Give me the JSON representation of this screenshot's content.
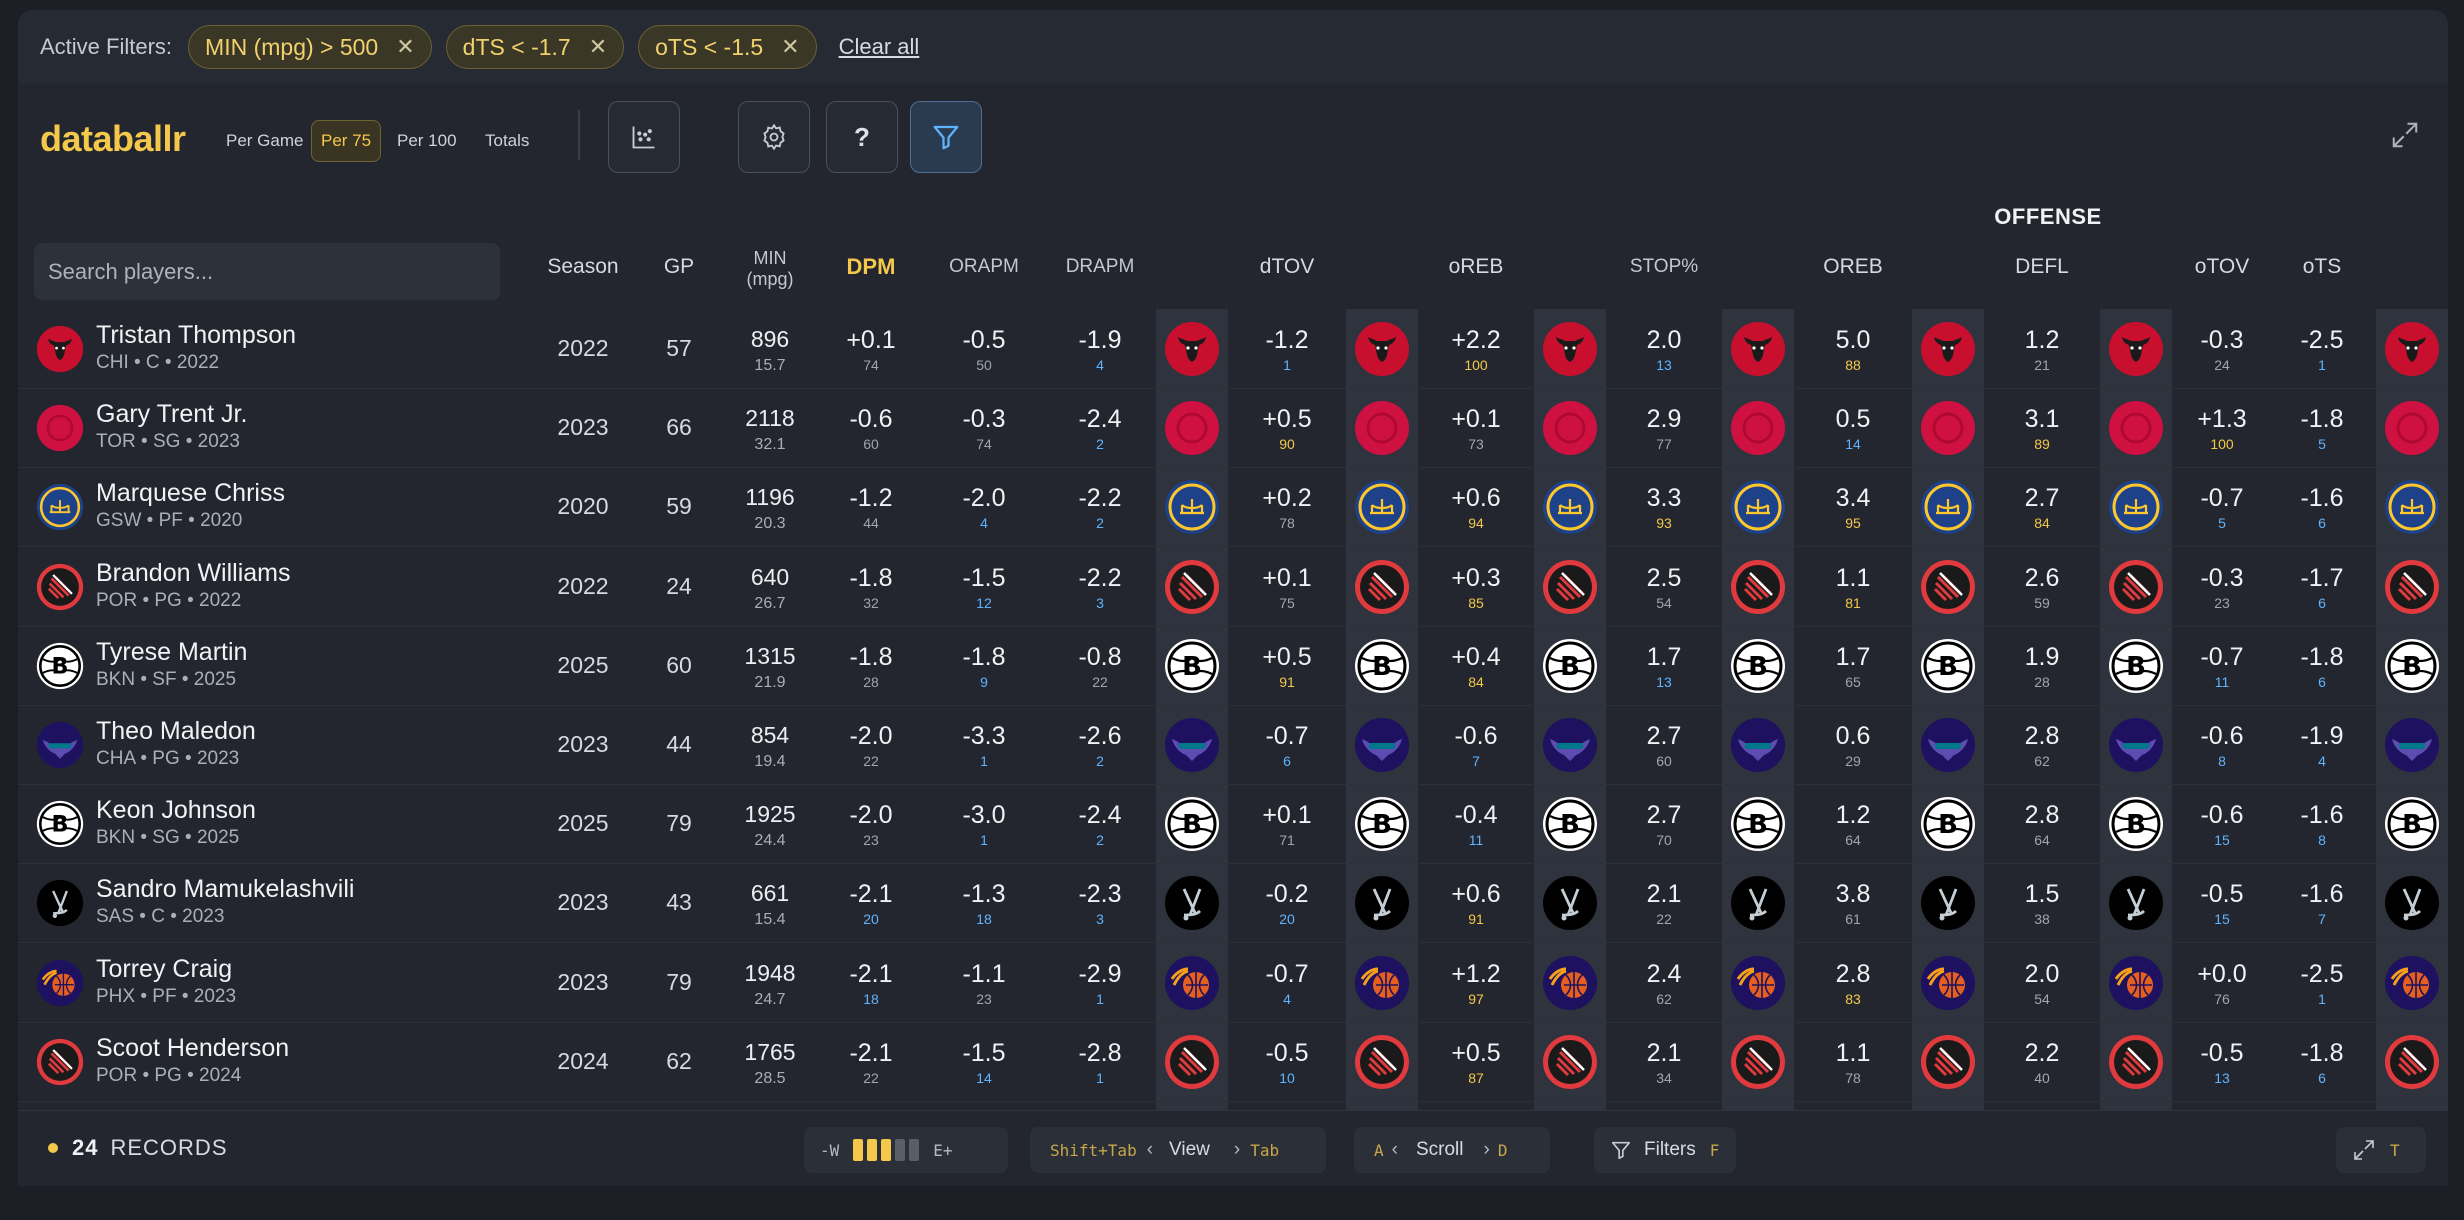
{
  "filters": {
    "label": "Active Filters:",
    "chips": [
      "MIN (mpg) > 500",
      "dTS < -1.7",
      "oTS < -1.5"
    ],
    "remove_symbol": "✕",
    "clear_all": "Clear all"
  },
  "toolbar": {
    "logo": "databallr",
    "modes": [
      "Per Game",
      "Per 75",
      "Per 100",
      "Totals"
    ],
    "active_mode": "Per 75",
    "buttons": [
      "chart-scatter-icon",
      "gear-icon",
      "help-icon",
      "filter-icon"
    ],
    "help_label": "?"
  },
  "table": {
    "group_header": "OFFENSE",
    "search_placeholder": "Search players...",
    "headers": {
      "season": "Season",
      "gp": "GP",
      "min_line1": "MIN",
      "min_line2": "(mpg)",
      "dpm": "DPM",
      "orapm": "ORAPM",
      "drapm": "DRAPM",
      "dtov": "dTOV",
      "oreb_lower": "oREB",
      "stop": "STOP%",
      "oreb": "OREB",
      "defl": "DEFL",
      "otov": "oTOV",
      "ots": "oTS"
    },
    "rows": [
      {
        "team": "CHI",
        "name": "Tristan Thompson",
        "meta": "CHI • C • 2022",
        "season": "2022",
        "gp": "57",
        "min": "896",
        "mpg": "15.7",
        "dpm": [
          "+0.1",
          "74"
        ],
        "orapm": [
          "-0.5",
          "50"
        ],
        "drapm": [
          "-1.9",
          "4"
        ],
        "dtov": [
          "-1.2",
          "1"
        ],
        "oreb_l": [
          "+2.2",
          "100"
        ],
        "stop": [
          "2.0",
          "13"
        ],
        "oreb": [
          "5.0",
          "88"
        ],
        "defl": [
          "1.2",
          "21"
        ],
        "otov": [
          "-0.3",
          "24"
        ],
        "ots": [
          "-2.5",
          "1"
        ]
      },
      {
        "team": "TOR",
        "name": "Gary Trent Jr.",
        "meta": "TOR • SG • 2023",
        "season": "2023",
        "gp": "66",
        "min": "2118",
        "mpg": "32.1",
        "dpm": [
          "-0.6",
          "60"
        ],
        "orapm": [
          "-0.3",
          "74"
        ],
        "drapm": [
          "-2.4",
          "2"
        ],
        "dtov": [
          "+0.5",
          "90"
        ],
        "oreb_l": [
          "+0.1",
          "73"
        ],
        "stop": [
          "2.9",
          "77"
        ],
        "oreb": [
          "0.5",
          "14"
        ],
        "defl": [
          "3.1",
          "89"
        ],
        "otov": [
          "+1.3",
          "100"
        ],
        "ots": [
          "-1.8",
          "5"
        ]
      },
      {
        "team": "GSW",
        "name": "Marquese Chriss",
        "meta": "GSW • PF • 2020",
        "season": "2020",
        "gp": "59",
        "min": "1196",
        "mpg": "20.3",
        "dpm": [
          "-1.2",
          "44"
        ],
        "orapm": [
          "-2.0",
          "4"
        ],
        "drapm": [
          "-2.2",
          "2"
        ],
        "dtov": [
          "+0.2",
          "78"
        ],
        "oreb_l": [
          "+0.6",
          "94"
        ],
        "stop": [
          "3.3",
          "93"
        ],
        "oreb": [
          "3.4",
          "95"
        ],
        "defl": [
          "2.7",
          "84"
        ],
        "otov": [
          "-0.7",
          "5"
        ],
        "ots": [
          "-1.6",
          "6"
        ]
      },
      {
        "team": "POR",
        "name": "Brandon Williams",
        "meta": "POR • PG • 2022",
        "season": "2022",
        "gp": "24",
        "min": "640",
        "mpg": "26.7",
        "dpm": [
          "-1.8",
          "32"
        ],
        "orapm": [
          "-1.5",
          "12"
        ],
        "drapm": [
          "-2.2",
          "3"
        ],
        "dtov": [
          "+0.1",
          "75"
        ],
        "oreb_l": [
          "+0.3",
          "85"
        ],
        "stop": [
          "2.5",
          "54"
        ],
        "oreb": [
          "1.1",
          "81"
        ],
        "defl": [
          "2.6",
          "59"
        ],
        "otov": [
          "-0.3",
          "23"
        ],
        "ots": [
          "-1.7",
          "6"
        ]
      },
      {
        "team": "BKN",
        "name": "Tyrese Martin",
        "meta": "BKN • SF • 2025",
        "season": "2025",
        "gp": "60",
        "min": "1315",
        "mpg": "21.9",
        "dpm": [
          "-1.8",
          "28"
        ],
        "orapm": [
          "-1.8",
          "9"
        ],
        "drapm": [
          "-0.8",
          "22"
        ],
        "dtov": [
          "+0.5",
          "91"
        ],
        "oreb_l": [
          "+0.4",
          "84"
        ],
        "stop": [
          "1.7",
          "13"
        ],
        "oreb": [
          "1.7",
          "65"
        ],
        "defl": [
          "1.9",
          "28"
        ],
        "otov": [
          "-0.7",
          "11"
        ],
        "ots": [
          "-1.8",
          "6"
        ]
      },
      {
        "team": "CHA",
        "name": "Theo Maledon",
        "meta": "CHA • PG • 2023",
        "season": "2023",
        "gp": "44",
        "min": "854",
        "mpg": "19.4",
        "dpm": [
          "-2.0",
          "22"
        ],
        "orapm": [
          "-3.3",
          "1"
        ],
        "drapm": [
          "-2.6",
          "2"
        ],
        "dtov": [
          "-0.7",
          "6"
        ],
        "oreb_l": [
          "-0.6",
          "7"
        ],
        "stop": [
          "2.7",
          "60"
        ],
        "oreb": [
          "0.6",
          "29"
        ],
        "defl": [
          "2.8",
          "62"
        ],
        "otov": [
          "-0.6",
          "8"
        ],
        "ots": [
          "-1.9",
          "4"
        ]
      },
      {
        "team": "BKN",
        "name": "Keon Johnson",
        "meta": "BKN • SG • 2025",
        "season": "2025",
        "gp": "79",
        "min": "1925",
        "mpg": "24.4",
        "dpm": [
          "-2.0",
          "23"
        ],
        "orapm": [
          "-3.0",
          "1"
        ],
        "drapm": [
          "-2.4",
          "2"
        ],
        "dtov": [
          "+0.1",
          "71"
        ],
        "oreb_l": [
          "-0.4",
          "11"
        ],
        "stop": [
          "2.7",
          "70"
        ],
        "oreb": [
          "1.2",
          "64"
        ],
        "defl": [
          "2.8",
          "64"
        ],
        "otov": [
          "-0.6",
          "15"
        ],
        "ots": [
          "-1.6",
          "8"
        ]
      },
      {
        "team": "SAS",
        "name": "Sandro Mamukelashvili",
        "meta": "SAS • C • 2023",
        "season": "2023",
        "gp": "43",
        "min": "661",
        "mpg": "15.4",
        "dpm": [
          "-2.1",
          "20"
        ],
        "orapm": [
          "-1.3",
          "18"
        ],
        "drapm": [
          "-2.3",
          "3"
        ],
        "dtov": [
          "-0.2",
          "20"
        ],
        "oreb_l": [
          "+0.6",
          "91"
        ],
        "stop": [
          "2.1",
          "22"
        ],
        "oreb": [
          "3.8",
          "61"
        ],
        "defl": [
          "1.5",
          "38"
        ],
        "otov": [
          "-0.5",
          "15"
        ],
        "ots": [
          "-1.6",
          "7"
        ]
      },
      {
        "team": "PHX",
        "name": "Torrey Craig",
        "meta": "PHX • PF • 2023",
        "season": "2023",
        "gp": "79",
        "min": "1948",
        "mpg": "24.7",
        "dpm": [
          "-2.1",
          "18"
        ],
        "orapm": [
          "-1.1",
          "23"
        ],
        "drapm": [
          "-2.9",
          "1"
        ],
        "dtov": [
          "-0.7",
          "4"
        ],
        "oreb_l": [
          "+1.2",
          "97"
        ],
        "stop": [
          "2.4",
          "62"
        ],
        "oreb": [
          "2.8",
          "83"
        ],
        "defl": [
          "2.0",
          "54"
        ],
        "otov": [
          "+0.0",
          "76"
        ],
        "ots": [
          "-2.5",
          "1"
        ]
      },
      {
        "team": "POR",
        "name": "Scoot Henderson",
        "meta": "POR • PG • 2024",
        "season": "2024",
        "gp": "62",
        "min": "1765",
        "mpg": "28.5",
        "dpm": [
          "-2.1",
          "22"
        ],
        "orapm": [
          "-1.5",
          "14"
        ],
        "drapm": [
          "-2.8",
          "1"
        ],
        "dtov": [
          "-0.5",
          "10"
        ],
        "oreb_l": [
          "+0.5",
          "87"
        ],
        "stop": [
          "2.1",
          "34"
        ],
        "oreb": [
          "1.1",
          "78"
        ],
        "defl": [
          "2.2",
          "40"
        ],
        "otov": [
          "-0.5",
          "13"
        ],
        "ots": [
          "-1.8",
          "6"
        ]
      }
    ]
  },
  "footer": {
    "count": "24",
    "records_label": "RECORDS",
    "width_minus": "-W",
    "width_plus": "E+",
    "view_prev_key": "Shift+Tab",
    "view_label": "View",
    "view_next_key": "Tab",
    "scroll_left_key": "A",
    "scroll_label": "Scroll",
    "scroll_right_key": "D",
    "filters_label": "Filters",
    "filters_key": "F",
    "fullscreen_key": "T",
    "chev_left": "‹",
    "chev_right": "›"
  },
  "colors": {
    "accent": "#f4c84a",
    "percentile_low": "#5fb4ff",
    "percentile_high": "#f4c84a"
  }
}
